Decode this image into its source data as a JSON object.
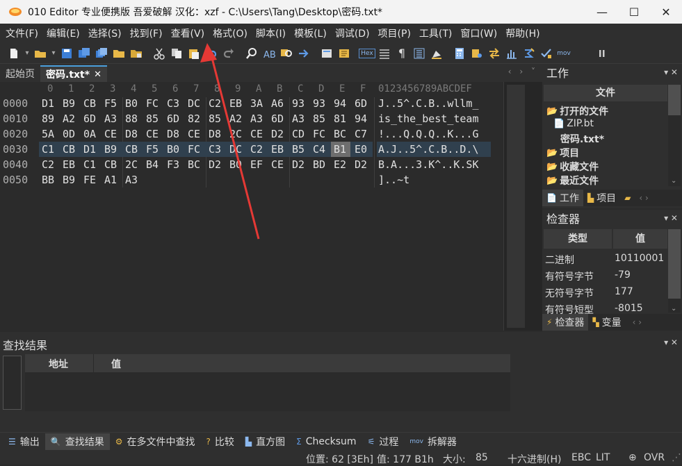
{
  "window": {
    "title": "010 Editor 专业便携版 吾爱破解  汉化：xzf - C:\\Users\\Tang\\Desktop\\密码.txt*",
    "minimize": "—",
    "maximize": "☐",
    "close": "✕"
  },
  "menu": [
    "文件(F)",
    "编辑(E)",
    "选择(S)",
    "找到(F)",
    "查看(V)",
    "格式(O)",
    "脚本(I)",
    "模板(L)",
    "调试(D)",
    "项目(P)",
    "工具(T)",
    "窗口(W)",
    "帮助(H)"
  ],
  "toolbar": {
    "hex_label": "Hex",
    "mov_label": "mov",
    "pilcrow": "¶"
  },
  "tabs": [
    {
      "label": "起始页",
      "active": false
    },
    {
      "label": "密码.txt*",
      "active": true,
      "close": "✕"
    }
  ],
  "tab_nav": "‹ › ˅",
  "hex": {
    "column_header": [
      "0",
      "1",
      "2",
      "3",
      "4",
      "5",
      "6",
      "7",
      "8",
      "9",
      "A",
      "B",
      "C",
      "D",
      "E",
      "F"
    ],
    "ascii_header": "0123456789ABCDEF",
    "rows": [
      {
        "addr": "0000",
        "bytes": [
          "D1",
          "B9",
          "CB",
          "F5",
          "B0",
          "FC",
          "C3",
          "DC",
          "C2",
          "EB",
          "3A",
          "A6",
          "93",
          "93",
          "94",
          "6D"
        ],
        "ascii": "J..5^.C.B..wllm_"
      },
      {
        "addr": "0010",
        "bytes": [
          "89",
          "A2",
          "6D",
          "A3",
          "88",
          "85",
          "6D",
          "82",
          "85",
          "A2",
          "A3",
          "6D",
          "A3",
          "85",
          "81",
          "94"
        ],
        "ascii": "is_the_best_team"
      },
      {
        "addr": "0020",
        "bytes": [
          "5A",
          "0D",
          "0A",
          "CE",
          "D8",
          "CE",
          "D8",
          "CE",
          "D8",
          "2C",
          "CE",
          "D2",
          "CD",
          "FC",
          "BC",
          "C7"
        ],
        "ascii": "!...Q.Q.Q..K...G"
      },
      {
        "addr": "0030",
        "bytes": [
          "C1",
          "CB",
          "D1",
          "B9",
          "CB",
          "F5",
          "B0",
          "FC",
          "C3",
          "DC",
          "C2",
          "EB",
          "B5",
          "C4",
          "B1",
          "E0"
        ],
        "ascii": "A.J..5^.C.B..D.\\"
      },
      {
        "addr": "0040",
        "bytes": [
          "C2",
          "EB",
          "C1",
          "CB",
          "2C",
          "B4",
          "F3",
          "BC",
          "D2",
          "B0",
          "EF",
          "CE",
          "D2",
          "BD",
          "E2",
          "D2"
        ],
        "ascii": "B.A...3.K^..K.SK"
      },
      {
        "addr": "0050",
        "bytes": [
          "BB",
          "B9",
          "FE",
          "A1",
          "A3"
        ],
        "ascii": "]..~t"
      }
    ]
  },
  "work_panel": {
    "title": "工作",
    "header": "文件",
    "items": [
      {
        "label": "打开的文件",
        "bold": true,
        "indent": 0
      },
      {
        "label": "ZIP.bt",
        "bold": false,
        "indent": 1
      },
      {
        "label": "密码.txt*",
        "bold": true,
        "indent": 2
      },
      {
        "label": "项目",
        "bold": true,
        "indent": 0
      },
      {
        "label": "收藏文件",
        "bold": true,
        "indent": 0
      },
      {
        "label": "最近文件",
        "bold": true,
        "indent": 0
      }
    ],
    "tabs": [
      "工作",
      "项目"
    ]
  },
  "inspector": {
    "title": "检查器",
    "col_type": "类型",
    "col_value": "值",
    "rows": [
      {
        "type": "二进制",
        "value": "10110001"
      },
      {
        "type": "有符号字节",
        "value": "-79"
      },
      {
        "type": "无符号字节",
        "value": "177"
      },
      {
        "type": "有符号短型",
        "value": "-8015"
      }
    ],
    "tabs": [
      "检查器",
      "变量"
    ]
  },
  "find_results": {
    "title": "查找结果",
    "col_address": "地址",
    "col_value": "值"
  },
  "bottom_tabs": [
    "输出",
    "查找结果",
    "在多文件中查找",
    "比较",
    "直方图",
    "Checksum",
    "过程",
    "拆解器"
  ],
  "status": {
    "position": "位置: 62 [3Eh]",
    "value": "值: 177 B1h",
    "size": "大小:",
    "size_value": "85",
    "mode": "十六进制(H)",
    "encoding": "EBC",
    "endian": "LIT",
    "insert": "OVR"
  },
  "colors": {
    "background": "#2b2b2b",
    "row_highlight": "#30404e",
    "selected_cell": "#6e6e6e",
    "annotation_arrow": "#e53935",
    "accent": "#4a9fdc"
  }
}
